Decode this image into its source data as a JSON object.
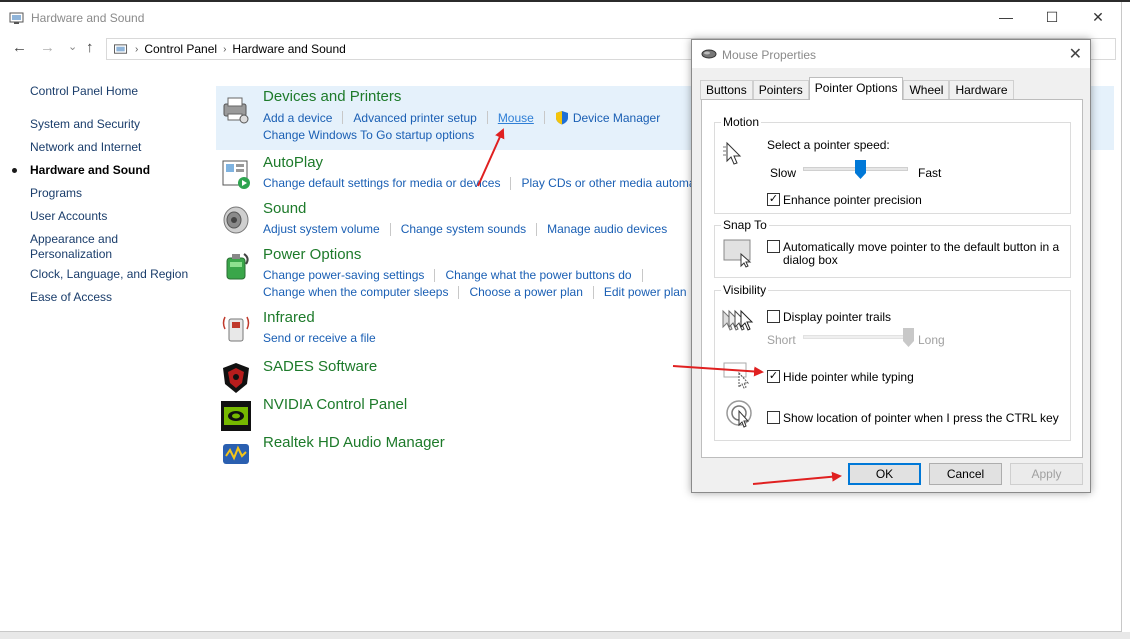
{
  "window": {
    "title": "Hardware and Sound",
    "controls": {
      "minimize": "—",
      "maximize": "☐",
      "close": "✕"
    }
  },
  "address": {
    "back": "←",
    "forward": "→",
    "recent": "⌄",
    "up": "↑",
    "crumbs": [
      "Control Panel",
      "Hardware and Sound"
    ],
    "separator": "›"
  },
  "sidebar": {
    "items": [
      {
        "label": "Control Panel Home",
        "active": false
      },
      {
        "label": "System and Security",
        "active": false
      },
      {
        "label": "Network and Internet",
        "active": false
      },
      {
        "label": "Hardware and Sound",
        "active": true
      },
      {
        "label": "Programs",
        "active": false
      },
      {
        "label": "User Accounts",
        "active": false
      },
      {
        "label": "Appearance and",
        "active": false
      },
      {
        "label": "Personalization",
        "active": false
      },
      {
        "label": "Clock, Language, and Region",
        "active": false
      },
      {
        "label": "Ease of Access",
        "active": false
      }
    ]
  },
  "categories": {
    "devices": {
      "title": "Devices and Printers",
      "links1": [
        "Add a device",
        "Advanced printer setup",
        "Mouse",
        "Device Manager"
      ],
      "links2": [
        "Change Windows To Go startup options"
      ]
    },
    "autoplay": {
      "title": "AutoPlay",
      "links1": [
        "Change default settings for media or devices",
        "Play CDs or other media automa"
      ]
    },
    "sound": {
      "title": "Sound",
      "links1": [
        "Adjust system volume",
        "Change system sounds",
        "Manage audio devices"
      ]
    },
    "power": {
      "title": "Power Options",
      "links1": [
        "Change power-saving settings",
        "Change what the power buttons do"
      ],
      "links2": [
        "Change when the computer sleeps",
        "Choose a power plan",
        "Edit power plan"
      ]
    },
    "infrared": {
      "title": "Infrared",
      "links1": [
        "Send or receive a file"
      ]
    },
    "sades": {
      "title": "SADES Software"
    },
    "nvidia": {
      "title": "NVIDIA Control Panel"
    },
    "realtek": {
      "title": "Realtek HD Audio Manager"
    }
  },
  "dialog": {
    "title": "Mouse Properties",
    "close": "✕",
    "tabs": [
      "Buttons",
      "Pointers",
      "Pointer Options",
      "Wheel",
      "Hardware"
    ],
    "active_tab": "Pointer Options",
    "motion": {
      "label": "Motion",
      "speed_label": "Select a pointer speed:",
      "slow": "Slow",
      "fast": "Fast",
      "speed_level": 0.55,
      "enhance_label": "Enhance pointer precision",
      "enhance_checked": true
    },
    "snap": {
      "label": "Snap To",
      "text": "Automatically move pointer to the default button in a dialog box",
      "text_line1": "Automatically move pointer to the default button in a",
      "text_line2": "dialog box",
      "checked": false
    },
    "visibility": {
      "label": "Visibility",
      "trails_label": "Display pointer trails",
      "trails_checked": false,
      "short": "Short",
      "long": "Long",
      "trails_level": 1.0,
      "hide_label": "Hide pointer while typing",
      "hide_checked": true,
      "ctrl_label": "Show location of pointer when I press the CTRL key",
      "ctrl_checked": false
    },
    "buttons": {
      "ok": "OK",
      "cancel": "Cancel",
      "apply": "Apply"
    },
    "check_mark": "✓"
  },
  "colors": {
    "category_title": "#1d7a2a",
    "link": "#1a5fb4",
    "highlight": "#e5f1fb",
    "annotation": "#e02020"
  }
}
